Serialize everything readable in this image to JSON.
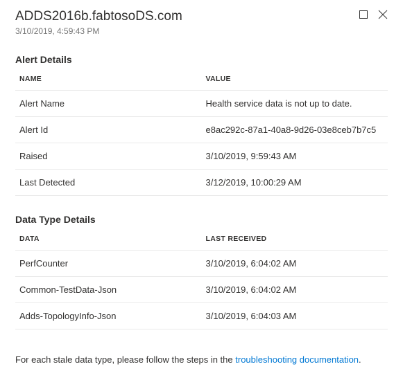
{
  "header": {
    "title": "ADDS2016b.fabtosoDS.com",
    "timestamp": "3/10/2019, 4:59:43 PM"
  },
  "alertDetails": {
    "sectionTitle": "Alert Details",
    "columns": {
      "name": "NAME",
      "value": "VALUE"
    },
    "rows": [
      {
        "name": "Alert Name",
        "value": "Health service data is not up to date."
      },
      {
        "name": "Alert Id",
        "value": "e8ac292c-87a1-40a8-9d26-03e8ceb7b7c5"
      },
      {
        "name": "Raised",
        "value": "3/10/2019, 9:59:43 AM"
      },
      {
        "name": "Last Detected",
        "value": "3/12/2019, 10:00:29 AM"
      }
    ]
  },
  "dataTypeDetails": {
    "sectionTitle": "Data Type Details",
    "columns": {
      "data": "DATA",
      "lastReceived": "LAST RECEIVED"
    },
    "rows": [
      {
        "data": "PerfCounter",
        "lastReceived": "3/10/2019, 6:04:02 AM"
      },
      {
        "data": "Common-TestData-Json",
        "lastReceived": "3/10/2019, 6:04:02 AM"
      },
      {
        "data": "Adds-TopologyInfo-Json",
        "lastReceived": "3/10/2019, 6:04:03 AM"
      }
    ]
  },
  "footer": {
    "prefix": "For each stale data type, please follow the steps in the ",
    "linkText": "troubleshooting documentation",
    "suffix": "."
  }
}
